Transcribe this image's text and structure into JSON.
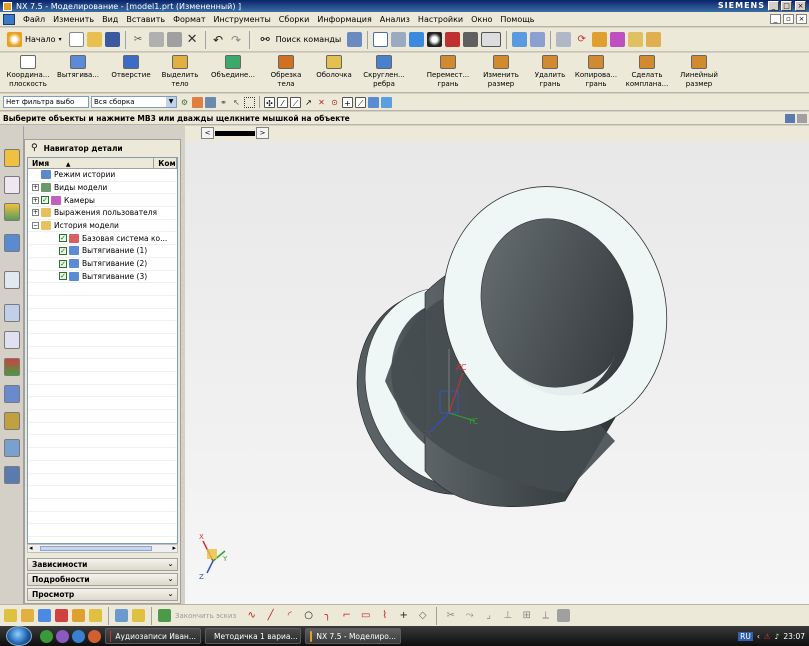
{
  "window": {
    "title": "NX 7.5 - Моделирование - [model1.prt (Измененный) ]",
    "brand": "SIEMENS"
  },
  "menu": [
    "Файл",
    "Изменить",
    "Вид",
    "Вставить",
    "Формат",
    "Инструменты",
    "Сборки",
    "Информация",
    "Анализ",
    "Настройки",
    "Окно",
    "Помощь"
  ],
  "toolbar1": {
    "start_label": "Начало",
    "command_search": "Поиск команды"
  },
  "feature_buttons": [
    {
      "label1": "Координа...",
      "label2": "плоскость",
      "color": "#ffffff"
    },
    {
      "label1": "Вытягива...",
      "label2": "",
      "color": "#5b8ad6"
    },
    {
      "label1": "Отверстие",
      "label2": "",
      "color": "#3c6cc8"
    },
    {
      "label1": "Выделить",
      "label2": "тело",
      "color": "#e0b040"
    },
    {
      "label1": "Объедине...",
      "label2": "",
      "color": "#3ca86a"
    },
    {
      "label1": "Обрезка",
      "label2": "тела",
      "color": "#d07020"
    },
    {
      "label1": "Оболочка",
      "label2": "",
      "color": "#e3c050"
    },
    {
      "label1": "Скруглен...",
      "label2": "ребра",
      "color": "#4a80d0"
    },
    {
      "label1": "Перемест...",
      "label2": "грань",
      "color": "#d28a30"
    },
    {
      "label1": "Изменить",
      "label2": "размер",
      "color": "#d28a30"
    },
    {
      "label1": "Удалить",
      "label2": "грань",
      "color": "#d28a30"
    },
    {
      "label1": "Копирова...",
      "label2": "грань",
      "color": "#d28a30"
    },
    {
      "label1": "Сделать",
      "label2": "компланa...",
      "color": "#d28a30"
    },
    {
      "label1": "Линейный",
      "label2": "размер",
      "color": "#d28a30"
    }
  ],
  "selection": {
    "filter": "Нет фильтра выбо",
    "scope": "Вся сборка"
  },
  "prompt": "Выберите объекты и нажмите МВ3 или дважды щелкните мышкой на объекте",
  "navigator": {
    "title": "Навигатор детали",
    "columns": [
      "Имя",
      "Комм"
    ],
    "rows": [
      {
        "label": "Режим истории",
        "level": 0,
        "expander": "",
        "check": false,
        "icon": "history-mode-icon",
        "color": "#5a8ac8"
      },
      {
        "label": "Виды модели",
        "level": 0,
        "expander": "+",
        "check": false,
        "icon": "model-views-icon",
        "color": "#6a9a6a"
      },
      {
        "label": "Камеры",
        "level": 0,
        "expander": "+",
        "check": true,
        "icon": "camera-icon",
        "color": "#c060c0"
      },
      {
        "label": "Выражения пользователя",
        "level": 0,
        "expander": "+",
        "check": false,
        "icon": "folder-icon",
        "color": "#e8c060"
      },
      {
        "label": "История модели",
        "level": 0,
        "expander": "−",
        "check": false,
        "icon": "folder-open-icon",
        "color": "#e8c060"
      },
      {
        "label": "Базовая система ко...",
        "level": 1,
        "expander": "",
        "check": true,
        "icon": "datum-csys-icon",
        "color": "#d86060"
      },
      {
        "label": "Вытягивание (1)",
        "level": 1,
        "expander": "",
        "check": true,
        "icon": "extrude-icon",
        "color": "#5b8ad6"
      },
      {
        "label": "Вытягивание (2)",
        "level": 1,
        "expander": "",
        "check": true,
        "icon": "extrude-icon",
        "color": "#5b8ad6"
      },
      {
        "label": "Вытягивание (3)",
        "level": 1,
        "expander": "",
        "check": true,
        "icon": "extrude-icon",
        "color": "#5b8ad6"
      }
    ],
    "panels": [
      "Зависимости",
      "Подробности",
      "Просмотр"
    ]
  },
  "graphics": {
    "axes": {
      "x": "XC",
      "y": "YC",
      "z": "ZC"
    },
    "triad": {
      "x": "X",
      "y": "Y",
      "z": "Z"
    }
  },
  "sketch_toolbar": {
    "finish_label": "Закончить эскиз"
  },
  "taskbar": {
    "tasks": [
      "Аудиозаписи Иван...",
      "Методичка 1 вариа...",
      "NX 7.5 - Моделиро..."
    ],
    "lang": "RU",
    "time": "23:07"
  },
  "colors": {
    "accent": "#3a6ea5",
    "body_dark": "#3e4549",
    "body_face": "#eef6f6"
  }
}
